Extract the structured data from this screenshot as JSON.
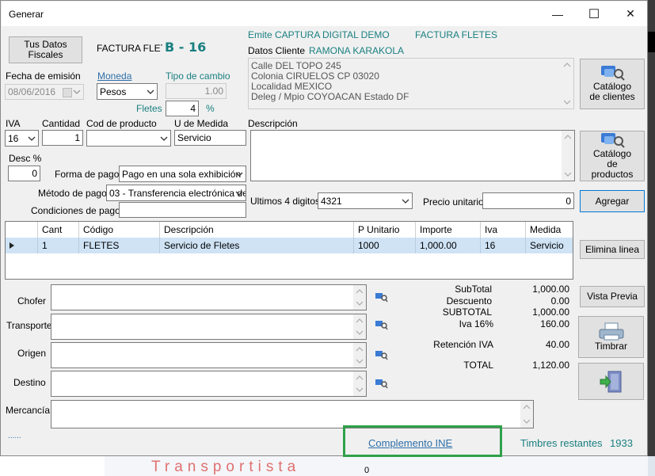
{
  "background": {
    "banner_text": "Transportista",
    "stray_value": "0"
  },
  "window": {
    "title": "Generar",
    "minimize_glyph": "—",
    "maximize_glyph": "☐",
    "close_glyph": "✕"
  },
  "header": {
    "tus_datos_fiscales": "Tus Datos Fiscales",
    "invoice_type": "FACTURA FLETE",
    "series_folio": "B - 16",
    "emite_label": "Emite",
    "emite_value": "CAPTURA DIGITAL DEMO",
    "document_type": "FACTURA FLETES",
    "datos_cliente_label": "Datos Cliente",
    "client_name": "RAMONA KARAKOLA"
  },
  "fields": {
    "fecha_emision_label": "Fecha de emisión",
    "fecha_emision_value": "08/06/2016",
    "moneda_label": "Moneda",
    "moneda_value": "Pesos",
    "tipo_cambio_label": "Tipo de cambio",
    "tipo_cambio_value": "1.00",
    "fletes_label": "Fletes",
    "fletes_value": "4",
    "fletes_unit": "%",
    "iva_label": "IVA",
    "iva_value": "16",
    "cantidad_label": "Cantidad",
    "cantidad_value": "1",
    "cod_producto_label": "Cod de producto",
    "cod_producto_value": "",
    "u_medida_label": "U de Medida",
    "u_medida_value": "Servicio",
    "desc_label": "Desc %",
    "desc_value": "0",
    "forma_pago_label": "Forma de pago",
    "forma_pago_value": "Pago en una sola exhibición",
    "metodo_pago_label": "Método de pago",
    "metodo_pago_value": "03 - Transferencia electrónica de",
    "condiciones_pago_label": "Condiciones de pago",
    "condiciones_pago_value": "",
    "descripcion_label": "Descripción",
    "ultimos_digitos_label": "Ultimos 4 digitos",
    "ultimos_digitos_value": "4321",
    "precio_unitario_label": "Precio unitario",
    "precio_unitario_value": "0"
  },
  "address": {
    "line1": "Calle DEL TOPO 245",
    "line2": "Colonia CIRUELOS  CP 03020",
    "line3": "Localidad MEXICO",
    "line4": "Deleg / Mpio COYOACAN   Estado DF"
  },
  "buttons": {
    "catalogo_clientes": "Catálogo de clientes",
    "catalogo_productos": "Catálogo de productos",
    "agregar": "Agregar",
    "elimina_linea": "Elimina linea",
    "vista_previa": "Vista Previa",
    "timbrar": "Timbrar"
  },
  "table": {
    "columns": [
      "Cant",
      "Código",
      "Descripción",
      "P Unitario",
      "Importe",
      "Iva",
      "Medida"
    ],
    "rows": [
      {
        "cant": "1",
        "codigo": "FLETES",
        "descripcion": "Servicio de Fletes",
        "p_unitario": "1000",
        "importe": "1,000.00",
        "iva": "16",
        "medida": "Servicio"
      }
    ]
  },
  "transport": {
    "chofer_label": "Chofer",
    "transporte_label": "Transporte",
    "origen_label": "Origen",
    "destino_label": "Destino",
    "mercancia_label": "Mercancía"
  },
  "totals": {
    "subtotal_label": "SubTotal",
    "subtotal_value": "1,000.00",
    "descuento_label": "Descuento",
    "descuento_value": "0.00",
    "subtotal2_label": "SUBTOTAL",
    "subtotal2_value": "1,000.00",
    "iva_label": "Iva 16%",
    "iva_value": "160.00",
    "retencion_label": "Retención IVA",
    "retencion_value": "40.00",
    "total_label": "TOTAL",
    "total_value": "1,120.00"
  },
  "footer": {
    "dots": "......",
    "complemento_ine": "Complemento INE",
    "timbres_label": "Timbres restantes",
    "timbres_value": "1933"
  },
  "colors": {
    "accent_teal": "#1a7f80",
    "link_blue": "#2d6fa8",
    "highlight_green": "#2fa14a",
    "selected_row": "#cfe3f5",
    "focus_blue": "#0078d7"
  }
}
